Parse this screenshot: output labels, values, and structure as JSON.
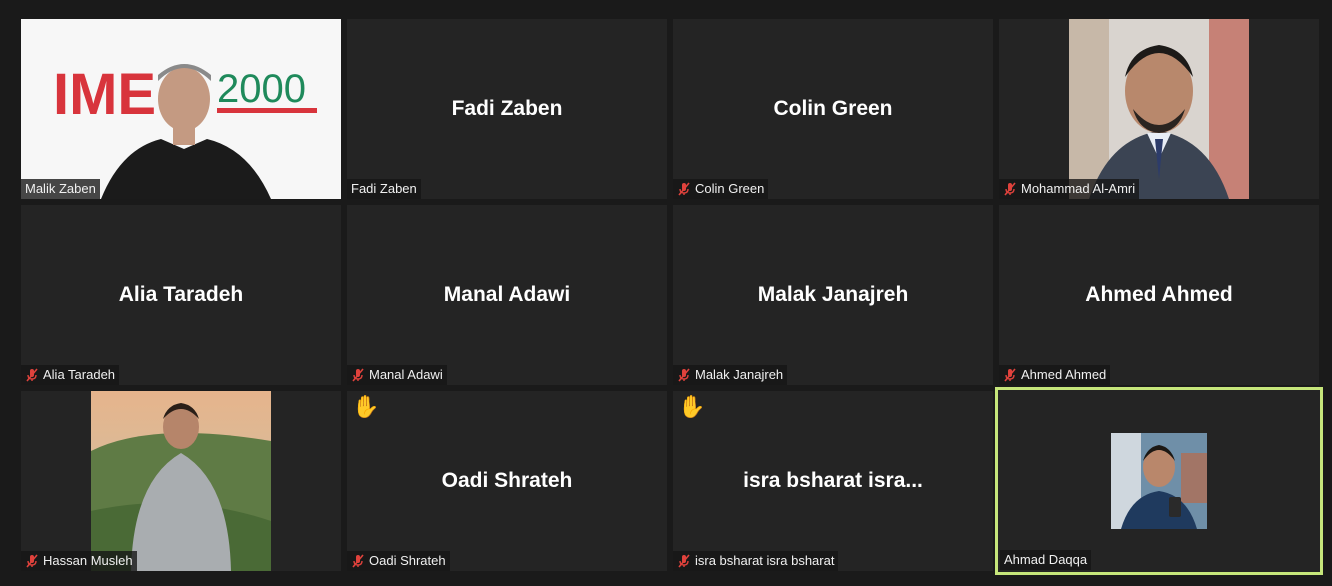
{
  "participants": [
    {
      "name": "Malik Zaben",
      "display": "",
      "label": "Malik Zaben",
      "muted": false,
      "hand_raised": false,
      "video": true
    },
    {
      "name": "Fadi Zaben",
      "display": "Fadi Zaben",
      "label": "Fadi Zaben",
      "muted": false,
      "hand_raised": false,
      "video": false
    },
    {
      "name": "Colin Green",
      "display": "Colin Green",
      "label": "Colin Green",
      "muted": true,
      "hand_raised": false,
      "video": false
    },
    {
      "name": "Mohammad Al-Amri",
      "display": "",
      "label": "Mohammad Al-Amri",
      "muted": true,
      "hand_raised": false,
      "video": true
    },
    {
      "name": "Alia Taradeh",
      "display": "Alia Taradeh",
      "label": "Alia Taradeh",
      "muted": true,
      "hand_raised": false,
      "video": false
    },
    {
      "name": "Manal Adawi",
      "display": "Manal Adawi",
      "label": "Manal Adawi",
      "muted": true,
      "hand_raised": false,
      "video": false
    },
    {
      "name": "Malak Janajreh",
      "display": "Malak Janajreh",
      "label": "Malak Janajreh",
      "muted": true,
      "hand_raised": false,
      "video": false
    },
    {
      "name": "Ahmed Ahmed",
      "display": "Ahmed Ahmed",
      "label": "Ahmed Ahmed",
      "muted": true,
      "hand_raised": false,
      "video": false
    },
    {
      "name": "Hassan Musleh",
      "display": "",
      "label": "Hassan Musleh",
      "muted": true,
      "hand_raised": false,
      "video": true
    },
    {
      "name": "Oadi Shrateh",
      "display": "Oadi Shrateh",
      "label": "Oadi Shrateh",
      "muted": true,
      "hand_raised": true,
      "video": false
    },
    {
      "name": "isra bsharat isra bsharat",
      "display": "isra bsharat isra...",
      "label": "isra bsharat isra bsharat",
      "muted": true,
      "hand_raised": true,
      "video": false
    },
    {
      "name": "Ahmad Daqqa",
      "display": "",
      "label": "Ahmad Daqqa",
      "muted": false,
      "hand_raised": false,
      "video": true,
      "active_speaker": true
    }
  ],
  "logo_text": {
    "part1": "IME",
    "part2": "2000"
  },
  "hand_glyph": "✋",
  "colors": {
    "tile_bg": "#242424",
    "page_bg": "#1a1a1a",
    "active_speaker_border": "#c6e67b",
    "muted_mic": "#e0423c",
    "logo_red": "#d8343c",
    "logo_green": "#1f8a5b"
  },
  "icons": {
    "muted": "mic-muted-icon",
    "hand": "raised-hand-icon"
  }
}
